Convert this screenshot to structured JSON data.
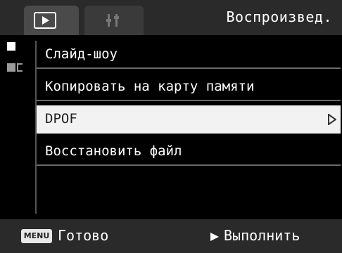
{
  "header": {
    "title": "Воспроизвед.",
    "tabs": [
      {
        "icon": "playback-icon",
        "active": true
      },
      {
        "icon": "setup-icon",
        "active": false
      }
    ]
  },
  "menu": {
    "items": [
      {
        "label": "Слайд-шоу",
        "selected": false
      },
      {
        "label": "Копировать на карту памяти",
        "selected": false
      },
      {
        "label": "DPOF",
        "selected": true,
        "has_submenu": true
      },
      {
        "label": "Восстановить файл",
        "selected": false
      }
    ]
  },
  "footer": {
    "menu_key": "MENU",
    "done_label": "Готово",
    "execute_label": "Выполнить"
  },
  "colors": {
    "background": "#000000",
    "bar": "#2a2a2a",
    "selected_row": "#f2f2f2",
    "text": "#ffffff"
  }
}
